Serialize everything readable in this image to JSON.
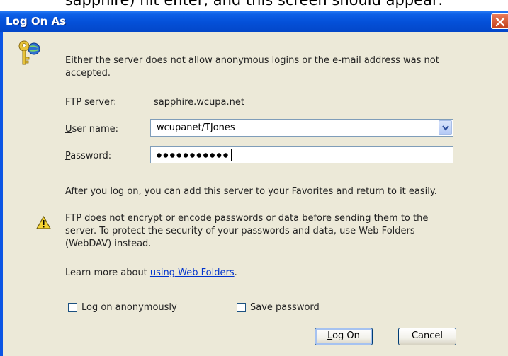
{
  "background_caption": "sapphire) hit enter, and this screen should appear:",
  "dialog": {
    "title": "Log On As",
    "info_message": "Either the server does not allow anonymous logins or the e-mail address was not accepted.",
    "info_message_line1": "Either the server does not allow anonymous logins or the e-mail address was not",
    "info_message_line2": "accepted.",
    "ftp_server_label": "FTP server:",
    "ftp_server_value": "sapphire.wcupa.net",
    "user_name_label": "User name:",
    "user_name_value": "wcupanet/TJones",
    "password_label": "Password:",
    "password_masked_length": 11,
    "after_logon_text": "After you log on, you can add this server to your Favorites and return to it easily.",
    "warning_line1": "FTP does not encrypt or encode passwords or data before sending them to the",
    "warning_line2": "server.  To protect the security of your passwords and data, use Web Folders",
    "warning_line3": "(WebDAV) instead.",
    "learn_more_prefix": "Learn more about ",
    "learn_more_link": "using Web Folders",
    "learn_more_suffix": ".",
    "anonymous_label": "Log on anonymously",
    "anonymous_checked": false,
    "save_password_label": "Save password",
    "save_password_checked": false,
    "logon_button": "Log On",
    "cancel_button": "Cancel"
  },
  "colors": {
    "titlebar": "#0450d8",
    "client_bg": "#ece9d8",
    "link": "#0033cc",
    "close": "#d9542b"
  },
  "icons": {
    "key_globe": "keys-globe-icon",
    "warning": "warning-icon",
    "close": "close-icon",
    "dropdown": "chevron-down-icon"
  }
}
